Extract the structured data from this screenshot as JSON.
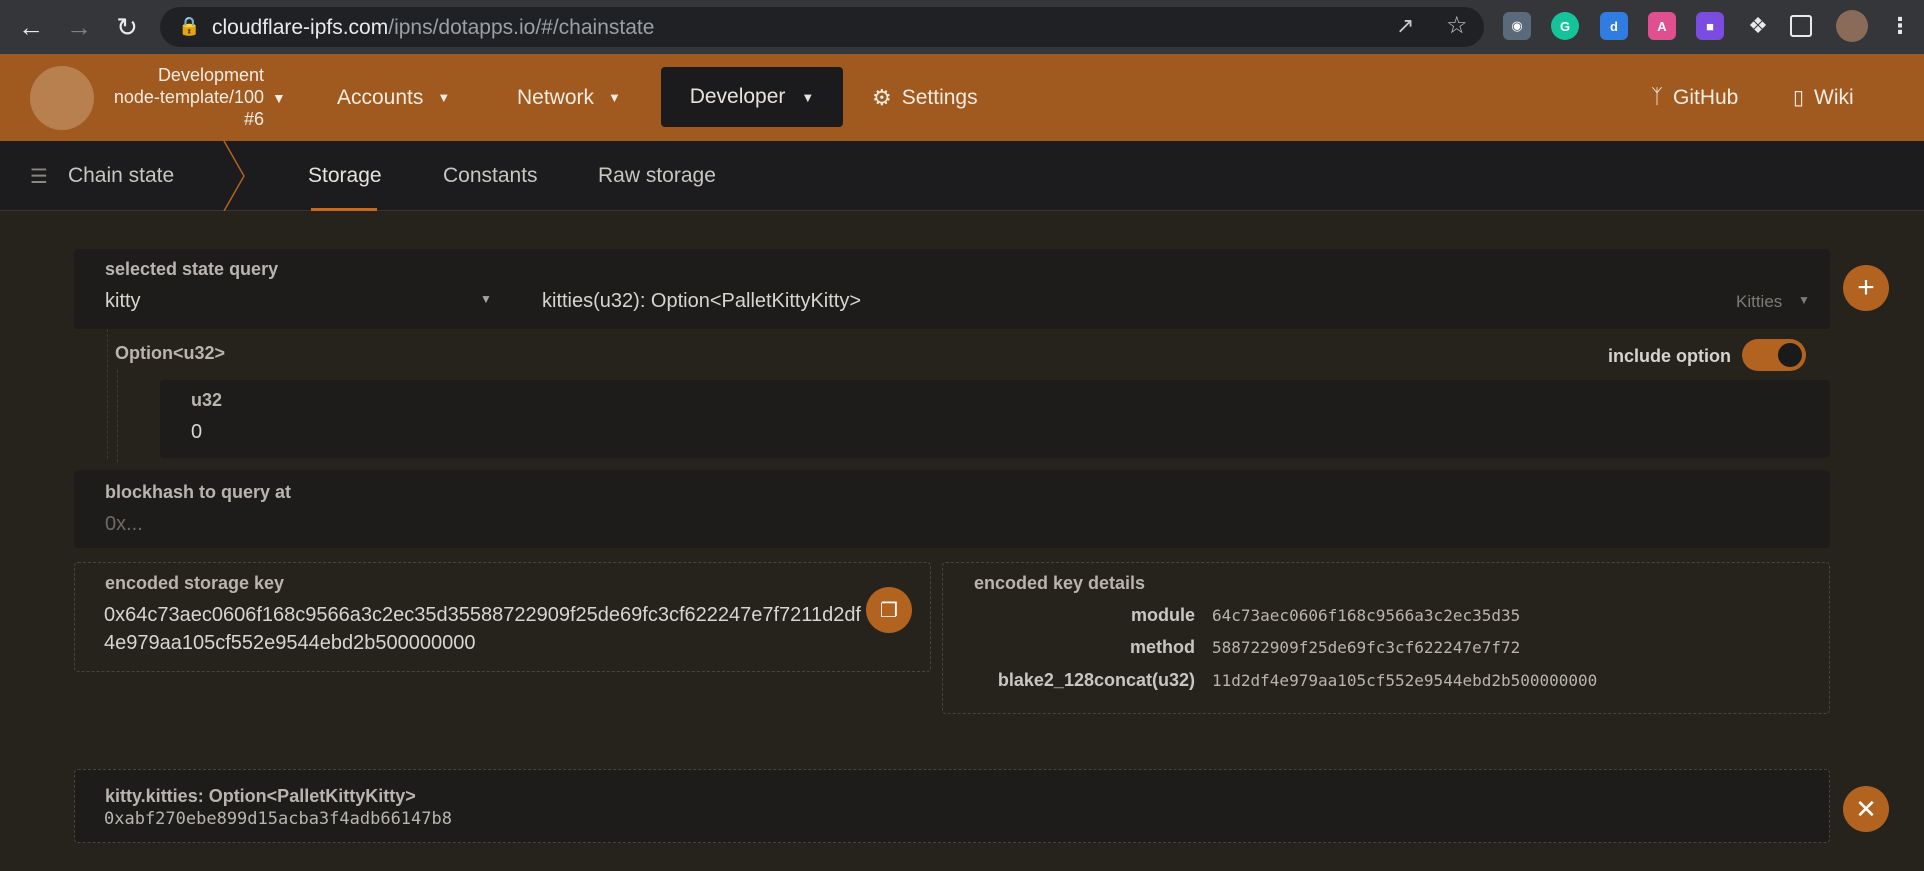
{
  "browser": {
    "url_host": "cloudflare-ipfs.com",
    "url_path": "/ipns/dotapps.io/#/chainstate"
  },
  "header": {
    "chain_name": "Development",
    "node_name": "node-template/100",
    "node_version": "#6",
    "menu": {
      "accounts": "Accounts",
      "network": "Network",
      "developer": "Developer",
      "settings": "Settings",
      "github": "GitHub",
      "wiki": "Wiki"
    }
  },
  "subnav": {
    "section": "Chain state",
    "tabs": [
      "Storage",
      "Constants",
      "Raw storage"
    ]
  },
  "query": {
    "label": "selected state query",
    "module": "kitty",
    "method_signature": "kitties(u32): Option<PalletKittyKitty>",
    "section_hint": "Kitties"
  },
  "param": {
    "option_type": "Option<u32>",
    "include_option_label": "include option",
    "include_option_on": true,
    "u32_label": "u32",
    "u32_value": "0"
  },
  "blockhash": {
    "label": "blockhash to query at",
    "placeholder": "0x..."
  },
  "encoded_key": {
    "label": "encoded storage key",
    "line1": "0x64c73aec0606f168c9566a3c2ec35d35588722909f25de69fc3cf622247e7f7211d2df",
    "line2": "4e979aa105cf552e9544ebd2b500000000"
  },
  "key_details": {
    "label": "encoded key details",
    "rows": [
      {
        "key": "module",
        "value": "64c73aec0606f168c9566a3c2ec35d35"
      },
      {
        "key": "method",
        "value": "588722909f25de69fc3cf622247e7f72"
      },
      {
        "key": "blake2_128concat(u32)",
        "value": "11d2df4e979aa105cf552e9544ebd2b500000000"
      }
    ]
  },
  "result": {
    "title": "kitty.kitties: Option<PalletKittyKitty>",
    "value": "0xabf270ebe899d15acba3f4adb66147b8"
  },
  "colors": {
    "accent": "#a0591f",
    "button": "#b2631f",
    "background": "#26221c"
  }
}
